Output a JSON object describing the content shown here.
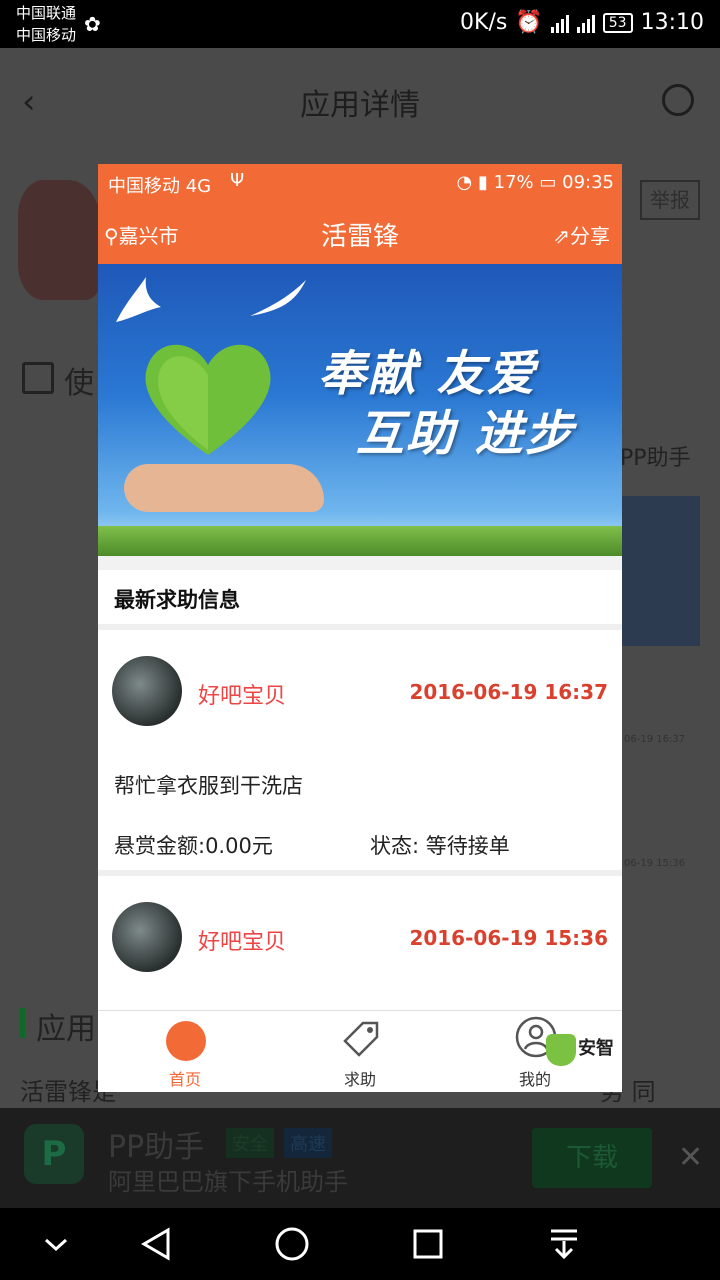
{
  "status_bar": {
    "carrier1": "中国联通",
    "carrier2": "中国移动",
    "net_speed": "0K/s",
    "battery": "53",
    "time": "13:10"
  },
  "background_page": {
    "title": "应用详情",
    "report_label": "举报",
    "checkbox_text": "使",
    "pp_label": "PP助手",
    "section_title": "应用",
    "desc_start": "活雷锋是",
    "desc_end": "务 同",
    "side_date_1": "06-19 16:37",
    "side_date_2": "06-19 15:36"
  },
  "ad": {
    "title": "PP助手",
    "tag_safe": "安全",
    "tag_fast": "高速",
    "subtitle": "阿里巴巴旗下手机助手",
    "download_label": "下载"
  },
  "inner_app": {
    "status": {
      "carrier": "中国移动 4G",
      "battery": "17%",
      "time": "09:35"
    },
    "header": {
      "city": "嘉兴市",
      "title": "活雷锋",
      "share": "分享"
    },
    "banner": {
      "line1": "奉献 友爱",
      "line2": "互助 进步"
    },
    "section_title": "最新求助信息",
    "posts": [
      {
        "user": "好吧宝贝",
        "time": "2016-06-19 16:37",
        "text": "帮忙拿衣服到干洗店",
        "reward": "悬赏金额:0.00元",
        "status": "状态: 等待接单"
      },
      {
        "user": "好吧宝贝",
        "time": "2016-06-19 15:36"
      }
    ],
    "tabs": [
      {
        "label": "首页",
        "icon": "home-icon"
      },
      {
        "label": "求助",
        "icon": "tag-icon"
      },
      {
        "label": "我的",
        "icon": "user-icon"
      }
    ],
    "watermark": "安智"
  }
}
